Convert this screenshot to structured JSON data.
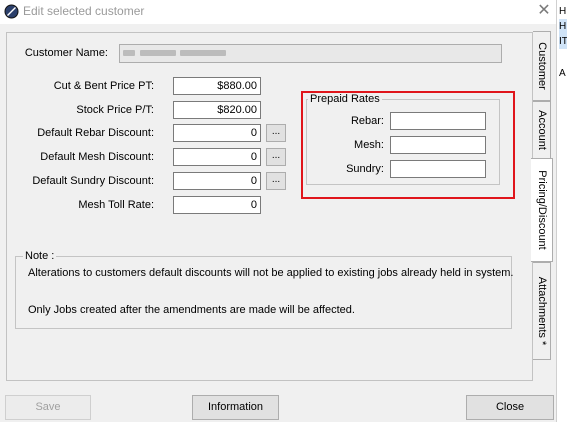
{
  "window": {
    "title": "Edit selected customer",
    "close_glyph": "✕"
  },
  "background_strip": [
    "H",
    "HI",
    "IT",
    "A"
  ],
  "form": {
    "customer_name_label": "Customer Name:",
    "rows": [
      {
        "label": "Cut & Bent Price PT:",
        "value": "$880.00",
        "has_picker": false
      },
      {
        "label": "Stock Price P/T:",
        "value": "$820.00",
        "has_picker": false
      },
      {
        "label": "Default Rebar Discount:",
        "value": "0",
        "has_picker": true
      },
      {
        "label": "Default Mesh Discount:",
        "value": "0",
        "has_picker": true
      },
      {
        "label": "Default Sundry Discount:",
        "value": "0",
        "has_picker": true
      },
      {
        "label": "Mesh Toll Rate:",
        "value": "0",
        "has_picker": false
      }
    ],
    "picker_label": "..."
  },
  "prepaid_rates": {
    "title": "Prepaid Rates",
    "rows": [
      {
        "label": "Rebar:",
        "value": ""
      },
      {
        "label": "Mesh:",
        "value": ""
      },
      {
        "label": "Sundry:",
        "value": ""
      }
    ],
    "highlight_color": "#e0151b"
  },
  "note": {
    "title": "Note :",
    "line1": "Alterations to customers default discounts will not be applied to existing jobs already held in system.",
    "line2": "Only Jobs created after the amendments are made will be affected."
  },
  "tabs": [
    {
      "label": "Customer",
      "active": false
    },
    {
      "label": "Account",
      "active": false
    },
    {
      "label": "Pricing/Discount",
      "active": true
    },
    {
      "label": "Attachments *",
      "active": false
    }
  ],
  "buttons": {
    "save": "Save",
    "information": "Information",
    "close": "Close"
  }
}
